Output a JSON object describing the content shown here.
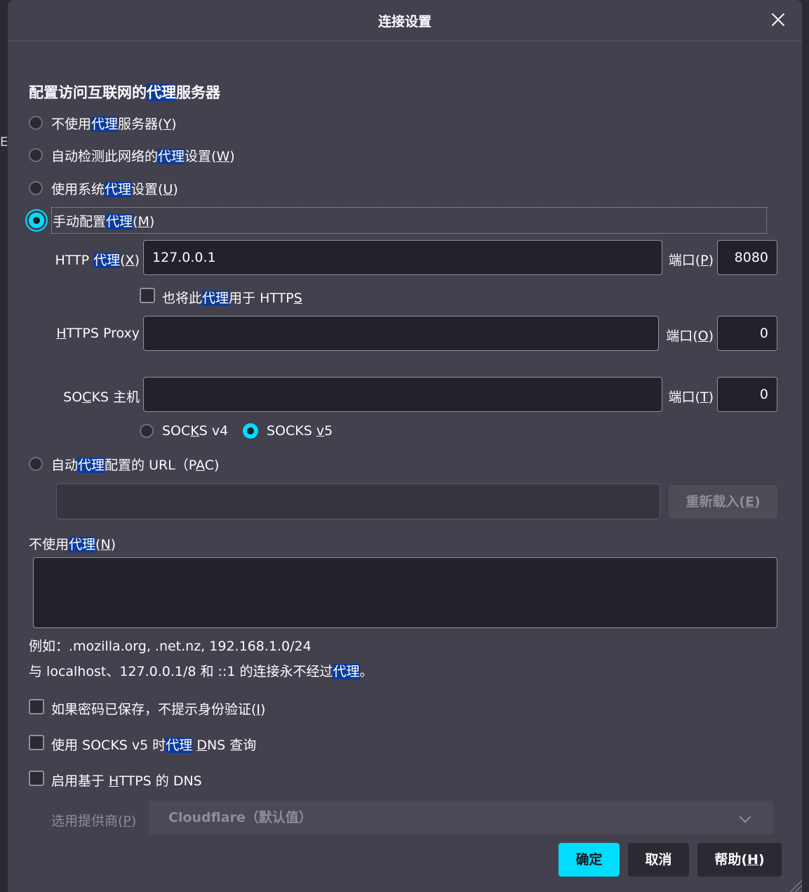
{
  "window": {
    "title": "连接设置",
    "edge_letter": "E"
  },
  "section": {
    "pre": "配置访问互联网的",
    "hl": "代理",
    "post": "服务器"
  },
  "radios": {
    "none": {
      "pre": "不使用",
      "hl": "代理",
      "post": "服务器(",
      "key": "Y",
      "end": ")"
    },
    "auto_detect": {
      "pre": "自动检测此网络的",
      "hl": "代理",
      "post": "设置(",
      "key": "W",
      "end": ")"
    },
    "system": {
      "pre": "使用系统",
      "hl": "代理",
      "post": "设置(",
      "key": "U",
      "end": ")"
    },
    "manual": {
      "pre": "手动配置",
      "hl": "代理",
      "post": "(",
      "key": "M",
      "end": ")",
      "selected": true
    },
    "pac": {
      "pre": "自动",
      "hl": "代理",
      "post": "配置的 URL（P",
      "key": "A",
      "end": "C)"
    }
  },
  "http": {
    "label_pre": "HTTP ",
    "label_hl": "代理",
    "label_post": "(",
    "label_key": "X",
    "label_end": ")",
    "value": "127.0.0.1",
    "port_pre": "端口(",
    "port_key": "P",
    "port_end": ")",
    "port": "8080"
  },
  "https_also": {
    "pre": "也将此",
    "hl": "代理",
    "post": "用于 HTTP",
    "key": "S"
  },
  "https": {
    "label_key": "H",
    "label_rest": "TTPS Proxy",
    "value": "",
    "port_pre": "端口(",
    "port_key": "O",
    "port_end": ")",
    "port": "0"
  },
  "socks": {
    "label_pre": "SO",
    "label_key": "C",
    "label_post": "KS 主机",
    "value": "",
    "port_pre": "端口(",
    "port_key": "T",
    "port_end": ")",
    "port": "0",
    "v4_pre": "SOC",
    "v4_key": "K",
    "v4_post": "S v4",
    "v5_pre": "SOCKS ",
    "v5_key": "v",
    "v5_post": "5",
    "selected": "v5"
  },
  "pac": {
    "url": "",
    "reload_pre": "重新载入(",
    "reload_key": "E",
    "reload_end": ")"
  },
  "no_proxy": {
    "pre": "不使用",
    "hl": "代理",
    "post": "(",
    "key": "N",
    "end": ")",
    "value": ""
  },
  "example": "例如：.mozilla.org, .net.nz, 192.168.1.0/24",
  "note": {
    "pre": "与 localhost、127.0.0.1/8 和 ::1 的连接永不经过",
    "hl": "代理",
    "post": "。"
  },
  "checkboxes": {
    "no_prompt": {
      "pre": "如果密码已保存，不提示身份验证(",
      "key": "I",
      "end": ")",
      "checked": false
    },
    "socks_dns": {
      "pre": "使用 SOCKS v5 时",
      "hl": "代理",
      "mid": " ",
      "key": "D",
      "post": "NS 查询",
      "checked": false
    },
    "doh": {
      "pre": "启用基于 ",
      "key": "H",
      "post": "TTPS 的 DNS",
      "checked": false
    }
  },
  "provider": {
    "label_pre": "选用提供商(",
    "label_key": "P",
    "label_end": ")",
    "value": "Cloudflare（默认值）"
  },
  "buttons": {
    "ok": "确定",
    "cancel": "取消",
    "help_pre": "帮助(",
    "help_key": "H",
    "help_end": ")"
  }
}
